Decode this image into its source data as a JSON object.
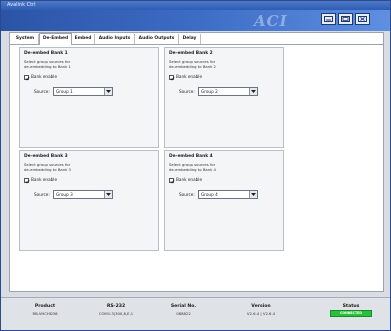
{
  "window": {
    "title": "Avalink Ctrl"
  },
  "header": {
    "logo_text": "ACI"
  },
  "window_buttons": [
    {
      "name": "minimize-button",
      "icon": "minimize-icon"
    },
    {
      "name": "maximize-button",
      "icon": "maximize-icon"
    },
    {
      "name": "close-button",
      "icon": "close-icon"
    }
  ],
  "tabs": [
    {
      "label": "System",
      "active": false
    },
    {
      "label": "De-Embed",
      "active": true
    },
    {
      "label": "Embed",
      "active": false
    },
    {
      "label": "Audio Inputs",
      "active": false
    },
    {
      "label": "Audio Outputs",
      "active": false
    },
    {
      "label": "Delay",
      "active": false
    }
  ],
  "banks": [
    {
      "title": "De-embed Bank 1",
      "description": "Select group sources for\nde-embedding to Bank 1",
      "enable_label": "Bank enable",
      "enabled": true,
      "source_label": "Source:",
      "source_value": "Group 1"
    },
    {
      "title": "De-embed Bank 2",
      "description": "Select group sources for\nde-embedding to Bank 2",
      "enable_label": "Bank enable",
      "enabled": true,
      "source_label": "Source:",
      "source_value": "Group 2"
    },
    {
      "title": "De-embed Bank 3",
      "description": "Select group sources for\nde-embedding to Bank 3",
      "enable_label": "Bank enable",
      "enabled": true,
      "source_label": "Source:",
      "source_value": "Group 3"
    },
    {
      "title": "De-embed Bank 4",
      "description": "Select group sources for\nde-embedding to Bank 4",
      "enable_label": "Bank enable",
      "enabled": true,
      "source_label": "Source:",
      "source_value": "Group 4"
    }
  ],
  "statusbar": {
    "product": {
      "label": "Product",
      "value": "RB-VHCHD36"
    },
    "rs232": {
      "label": "RS-232",
      "value": "COM1:3|300,8,E,1"
    },
    "serial": {
      "label": "Serial No.",
      "value": "088822"
    },
    "version": {
      "label": "Version",
      "value": "V2.6.4 | V2.6.4"
    },
    "status": {
      "label": "Status",
      "value": "CONNECTED"
    }
  },
  "colors": {
    "accent": "#3d6cc5",
    "status_ok": "#25c23a"
  }
}
